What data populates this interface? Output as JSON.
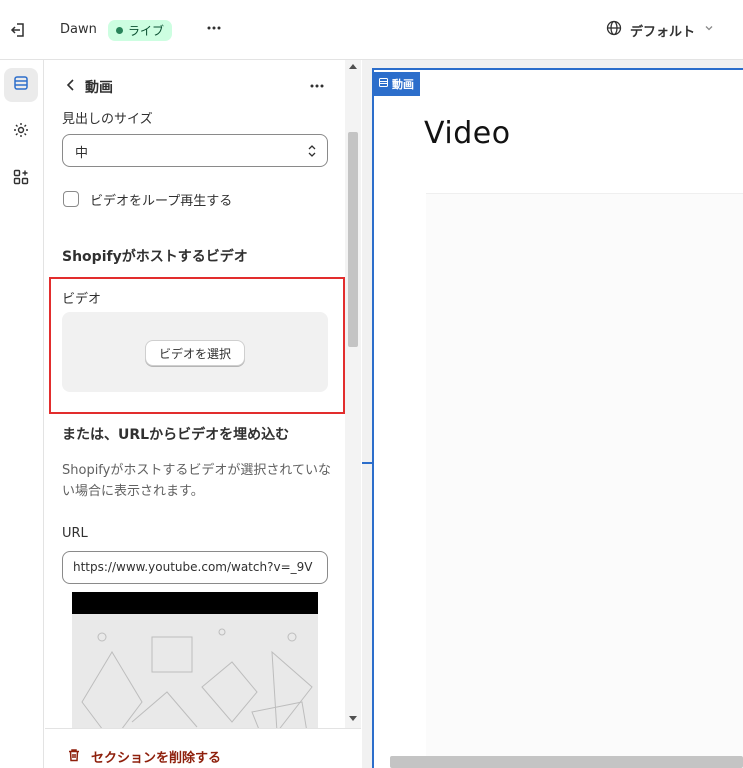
{
  "topbar": {
    "theme_name": "Dawn",
    "status_badge": "ライブ",
    "language_selector": "デフォルト"
  },
  "panel": {
    "title": "動画",
    "heading_size": {
      "label": "見出しのサイズ",
      "value": "中"
    },
    "loop_checkbox": {
      "label": "ビデオをループ再生する",
      "checked": false
    },
    "hosted_section_title": "Shopifyがホストするビデオ",
    "video_field": {
      "label": "ビデオ",
      "button_label": "ビデオを選択"
    },
    "url_section_title": "または、URLからビデオを埋め込む",
    "help_text": "Shopifyがホストするビデオが選択されていない場合に表示されます。",
    "url_field": {
      "label": "URL",
      "value": "https://www.youtube.com/watch?v=_9V"
    },
    "delete_button": "セクションを削除する"
  },
  "preview": {
    "section_tag": "動画",
    "heading": "Video"
  },
  "colors": {
    "accent_blue": "#2c6ecb",
    "highlight_red": "#e22d2d",
    "live_badge_bg": "#cdfee1",
    "delete_red": "#8e1f0b"
  }
}
